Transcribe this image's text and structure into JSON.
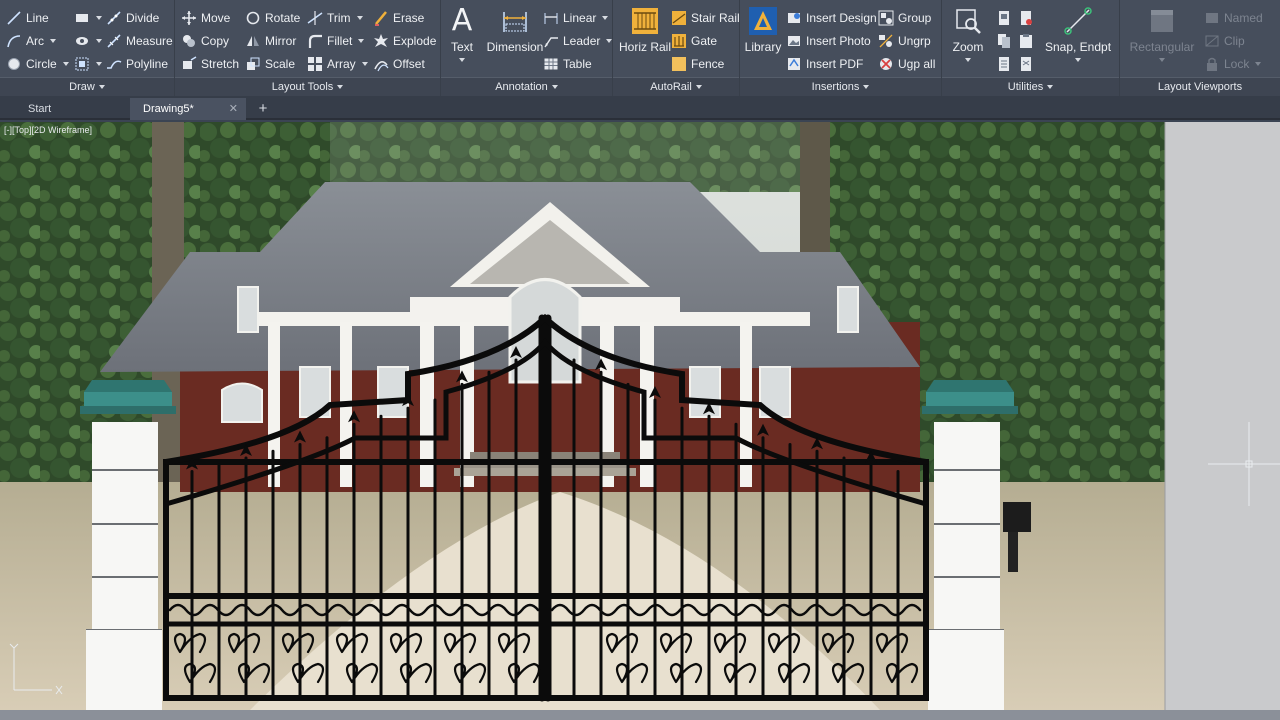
{
  "ribbon": {
    "draw": {
      "title": "Draw",
      "line": "Line",
      "arc": "Arc",
      "circle": "Circle",
      "divide": "Divide",
      "measure": "Measure",
      "polyline": "Polyline"
    },
    "layout_tools": {
      "title": "Layout Tools",
      "move": "Move",
      "copy": "Copy",
      "stretch": "Stretch",
      "rotate": "Rotate",
      "mirror": "Mirror",
      "scale": "Scale",
      "trim": "Trim",
      "fillet": "Fillet",
      "array": "Array",
      "erase": "Erase",
      "explode": "Explode",
      "offset": "Offset"
    },
    "annotation": {
      "title": "Annotation",
      "text": "Text",
      "dimension": "Dimension",
      "linear": "Linear",
      "leader": "Leader",
      "table": "Table"
    },
    "autorail": {
      "title": "AutoRail",
      "horiz_rail": "Horiz Rail",
      "stair_rail": "Stair Rail",
      "gate": "Gate",
      "fence": "Fence"
    },
    "insertions": {
      "title": "Insertions",
      "library": "Library",
      "insert_design": "Insert Design",
      "insert_photo": "Insert Photo",
      "insert_pdf": "Insert PDF",
      "group": "Group",
      "ungrp": "Ungrp",
      "ugp_all": "Ugp all"
    },
    "utilities": {
      "title": "Utilities",
      "zoom": "Zoom",
      "snap": "Snap, Endpt"
    },
    "layout_viewports": {
      "title": "Layout Viewports",
      "rectangular": "Rectangular",
      "named": "Named",
      "clip": "Clip",
      "lock": "Lock"
    }
  },
  "tabs": [
    {
      "label": "Start"
    },
    {
      "label": "Drawing5*"
    }
  ],
  "viewport": {
    "label": "[-][Top][2D Wireframe]"
  },
  "colors": {
    "ribbon_bg": "#464e5c",
    "cap_teal": "#3c8f8a",
    "gate_iron": "#0b0b0b",
    "model_space": "#c9cacc"
  }
}
